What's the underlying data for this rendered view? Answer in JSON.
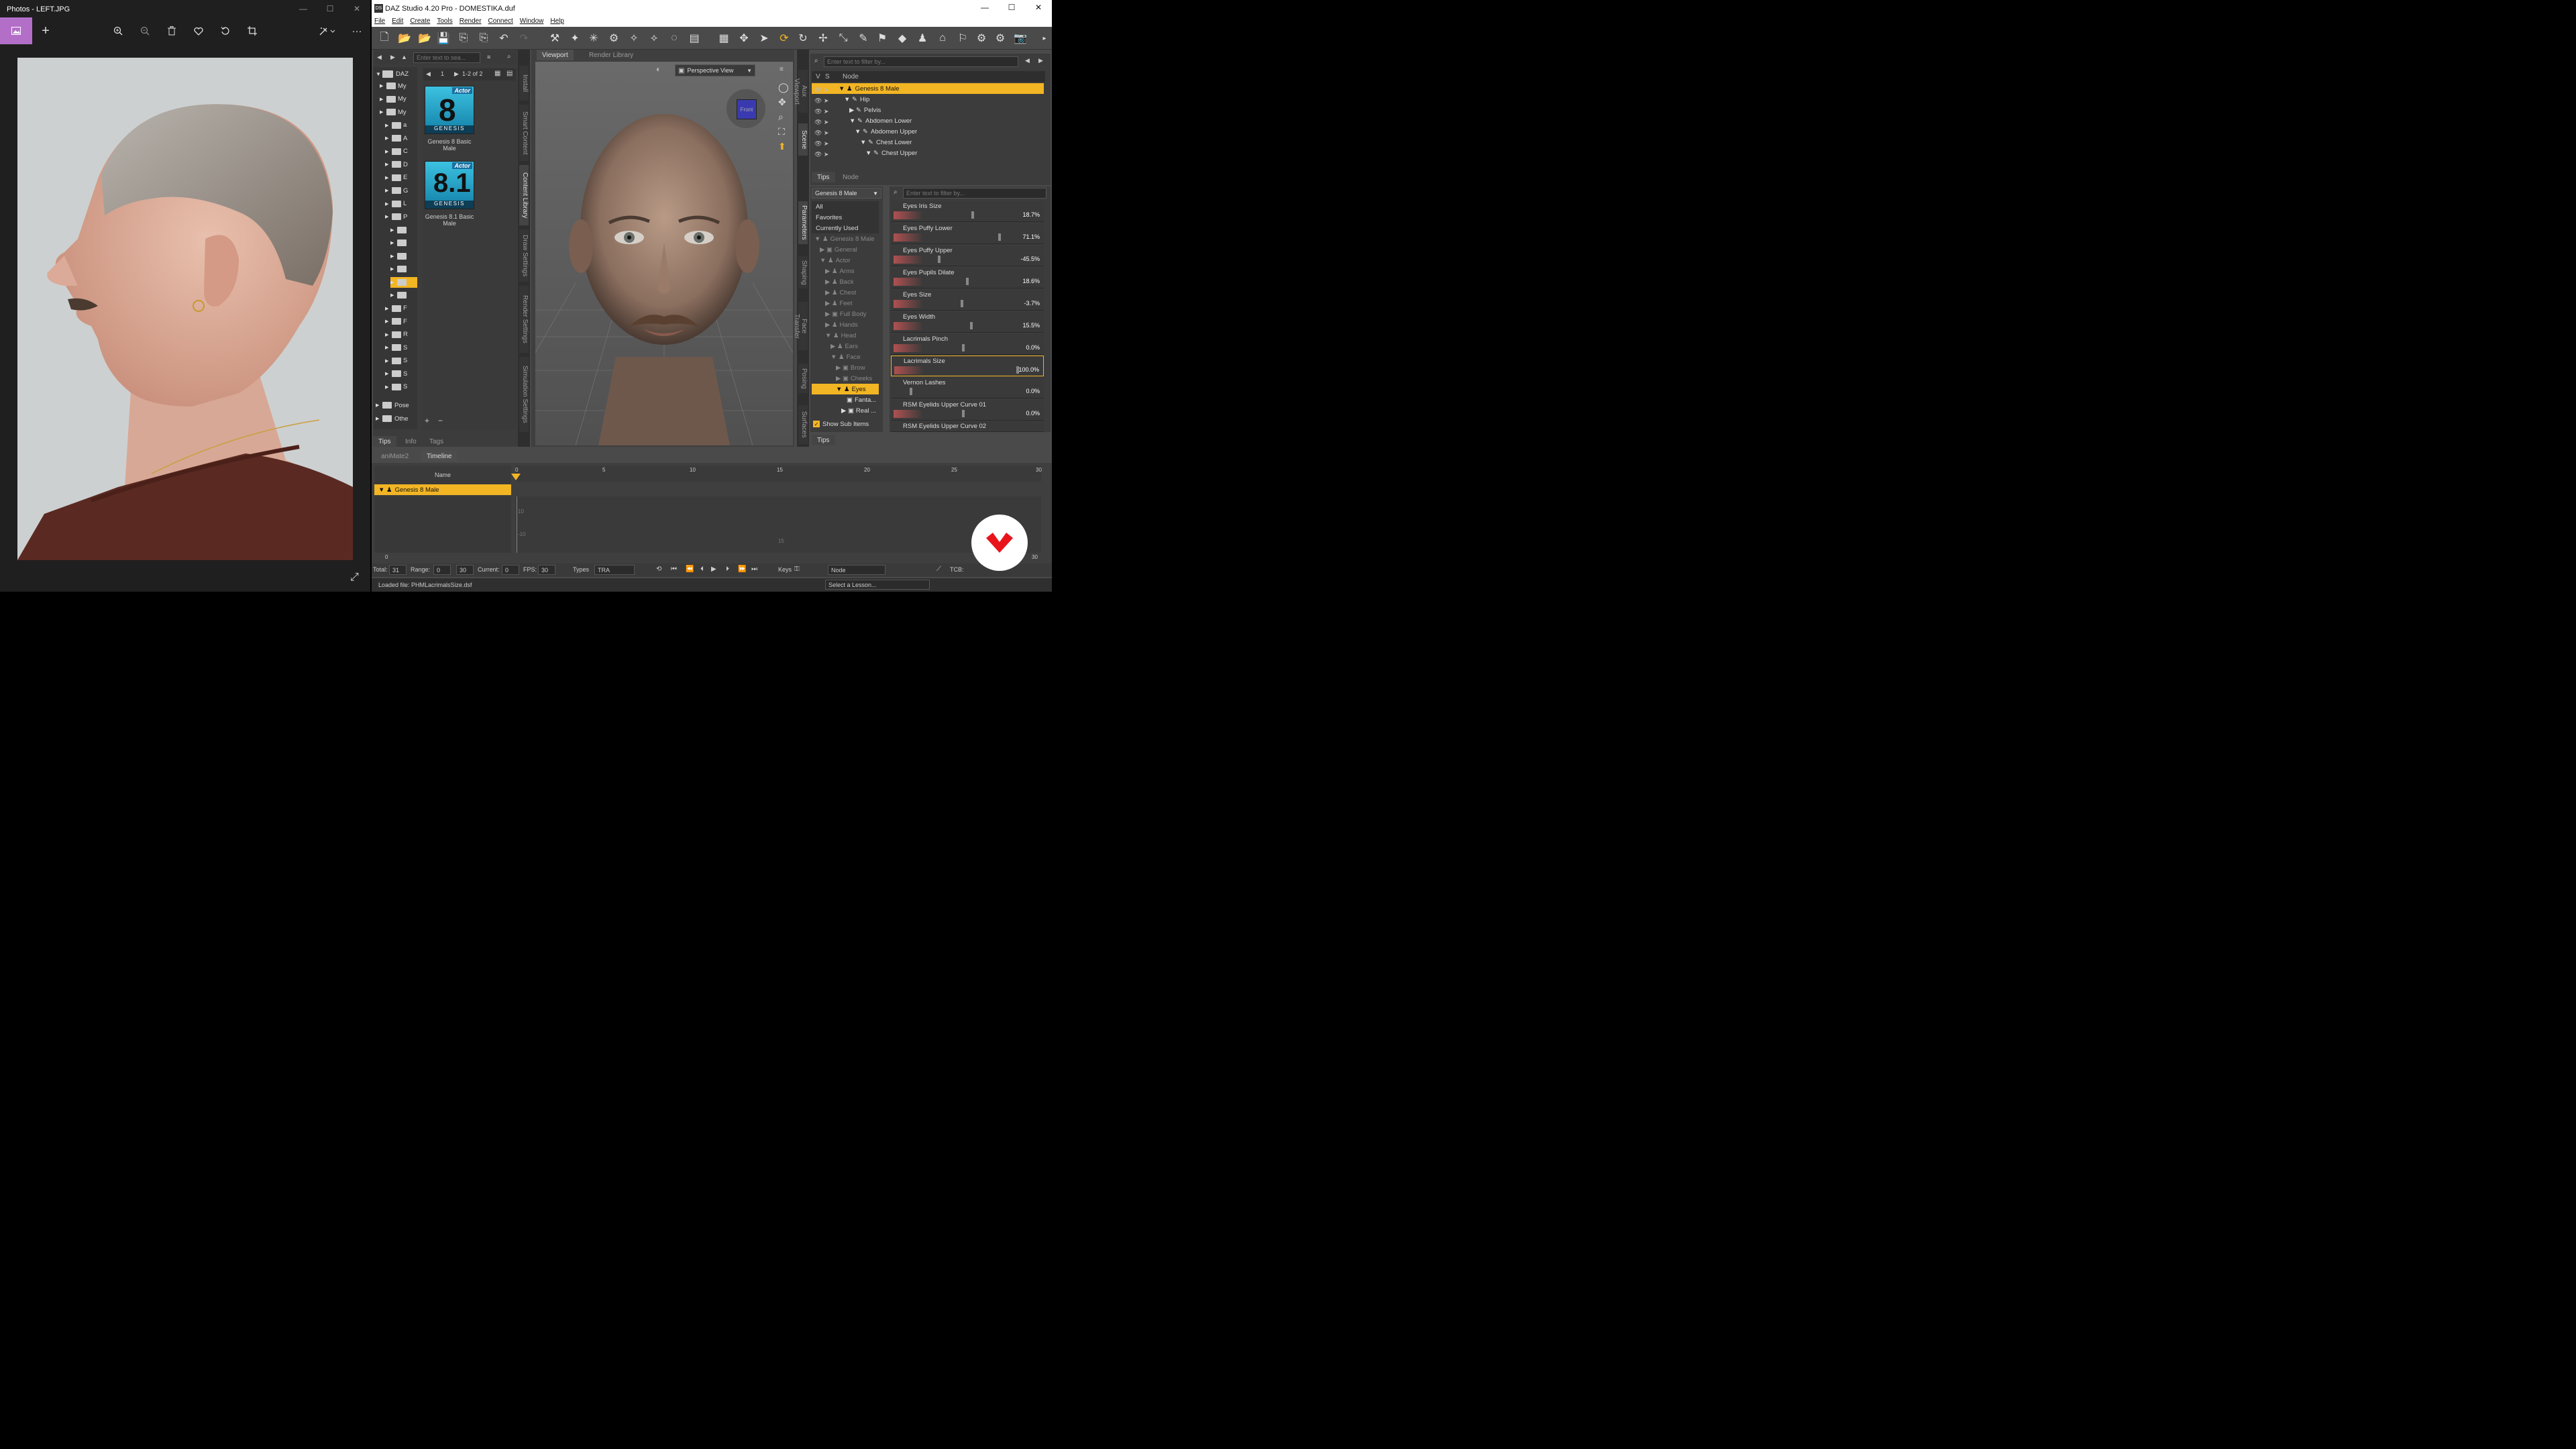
{
  "photos": {
    "title": "Photos - LEFT.JPG",
    "min": "—",
    "max": "☐",
    "close": "✕",
    "tools": [
      "zoom-in",
      "zoom-out",
      "delete",
      "favorite",
      "rotate",
      "crop"
    ],
    "more": "···"
  },
  "daz": {
    "title": "DAZ Studio 4.20 Pro - DOMESTIKA.duf",
    "logo": "DS",
    "min": "—",
    "max": "☐",
    "close": "✕",
    "menu": [
      "File",
      "Edit",
      "Create",
      "Tools",
      "Render",
      "Connect",
      "Window",
      "Help"
    ],
    "content": {
      "search_placeholder": "Enter text to sea...",
      "root": "DAZ",
      "folders": [
        "My",
        "My",
        "My",
        "a",
        "A",
        "C",
        "D",
        "E",
        "G",
        "L",
        "P",
        "",
        "",
        "",
        "",
        "",
        "",
        "F",
        "F",
        "R",
        "S",
        "S",
        "S",
        "S"
      ],
      "pose": "Pose",
      "other": "Othe",
      "pager": "1-2 of 2",
      "page_num": "1",
      "items": [
        {
          "name": "Genesis 8 Basic Male",
          "badge": "Actor",
          "brand": "GENESIS",
          "num": "8"
        },
        {
          "name": "Genesis 8.1 Basic Male",
          "badge": "Actor",
          "brand": "GENESIS",
          "num": "8.1"
        }
      ],
      "tabs": [
        "Tips",
        "Info",
        "Tags"
      ]
    },
    "vtabs_left": [
      "Install",
      "Smart Content",
      "Content Library",
      "Draw Settings",
      "Render Settings",
      "Simulation Settings"
    ],
    "viewport": {
      "tabs": [
        "Viewport",
        "Render Library"
      ],
      "view": "Perspective View",
      "cube": "Front"
    },
    "scene": {
      "filter_placeholder": "Enter text to filter by...",
      "cols": [
        "V",
        "S",
        "Node"
      ],
      "nodes": [
        "Genesis 8 Male",
        "Hip",
        "Pelvis",
        "Abdomen Lower",
        "Abdomen Upper",
        "Chest Lower",
        "Chest Upper"
      ],
      "tabs": [
        "Tips",
        "Node"
      ]
    },
    "vtabs_right": [
      "Aux Viewport",
      "Scene",
      "Parameters",
      "Shaping",
      "Face Transfer",
      "Posing",
      "Surfaces"
    ],
    "params": {
      "node_select": "Genesis 8 Male",
      "filter_placeholder": "Enter text to filter by...",
      "tree": [
        "All",
        "Favorites",
        "Currently Used",
        "Genesis 8 Male",
        "General",
        "Actor",
        "Arms",
        "Back",
        "Chest",
        "Feet",
        "Full Body",
        "Hands",
        "Head",
        "Ears",
        "Face",
        "Brow",
        "Cheeks",
        "Eyes",
        "Fanta...",
        "Real ..."
      ],
      "show_sub": "Show Sub Items",
      "sliders": [
        {
          "label": "Eyes Iris Size",
          "value": "18.7%"
        },
        {
          "label": "Eyes Puffy Lower",
          "value": "71.1%"
        },
        {
          "label": "Eyes Puffy Upper",
          "value": "-45.5%"
        },
        {
          "label": "Eyes Pupils Dilate",
          "value": "18.6%"
        },
        {
          "label": "Eyes Size",
          "value": "-3.7%"
        },
        {
          "label": "Eyes Width",
          "value": "15.5%"
        },
        {
          "label": "Lacrimals Pinch",
          "value": "0.0%"
        },
        {
          "label": "Lacrimals Size",
          "value": "100.0%"
        },
        {
          "label": "Vernon Lashes",
          "value": "0.0%"
        },
        {
          "label": "RSM Eyelids Upper Curve 01",
          "value": "0.0%"
        },
        {
          "label": "RSM Eyelids Upper Curve 02",
          "value": ""
        }
      ],
      "tabs": [
        "Tips"
      ]
    },
    "timeline": {
      "tabs": [
        "aniMate2",
        "Timeline"
      ],
      "name_col": "Name",
      "node": "Genesis 8 Male",
      "ticks": [
        "0",
        "5",
        "10",
        "15",
        "20",
        "25",
        "30"
      ],
      "inner": [
        "10",
        "-10",
        "15"
      ],
      "start": "0",
      "end": "30",
      "total_label": "Total:",
      "total": "31",
      "range_label": "Range:",
      "range_from": "0",
      "range_to": "30",
      "current_label": "Current:",
      "current": "0",
      "fps_label": "FPS:",
      "fps": "30",
      "types_label": "Types",
      "types": "TRA",
      "keys_label": "Keys",
      "keys_node": "Node",
      "tcb_label": "TCB:"
    },
    "status": "Loaded file: PHMLacrimalsSize.dsf",
    "lesson": "Select a Lesson..."
  }
}
